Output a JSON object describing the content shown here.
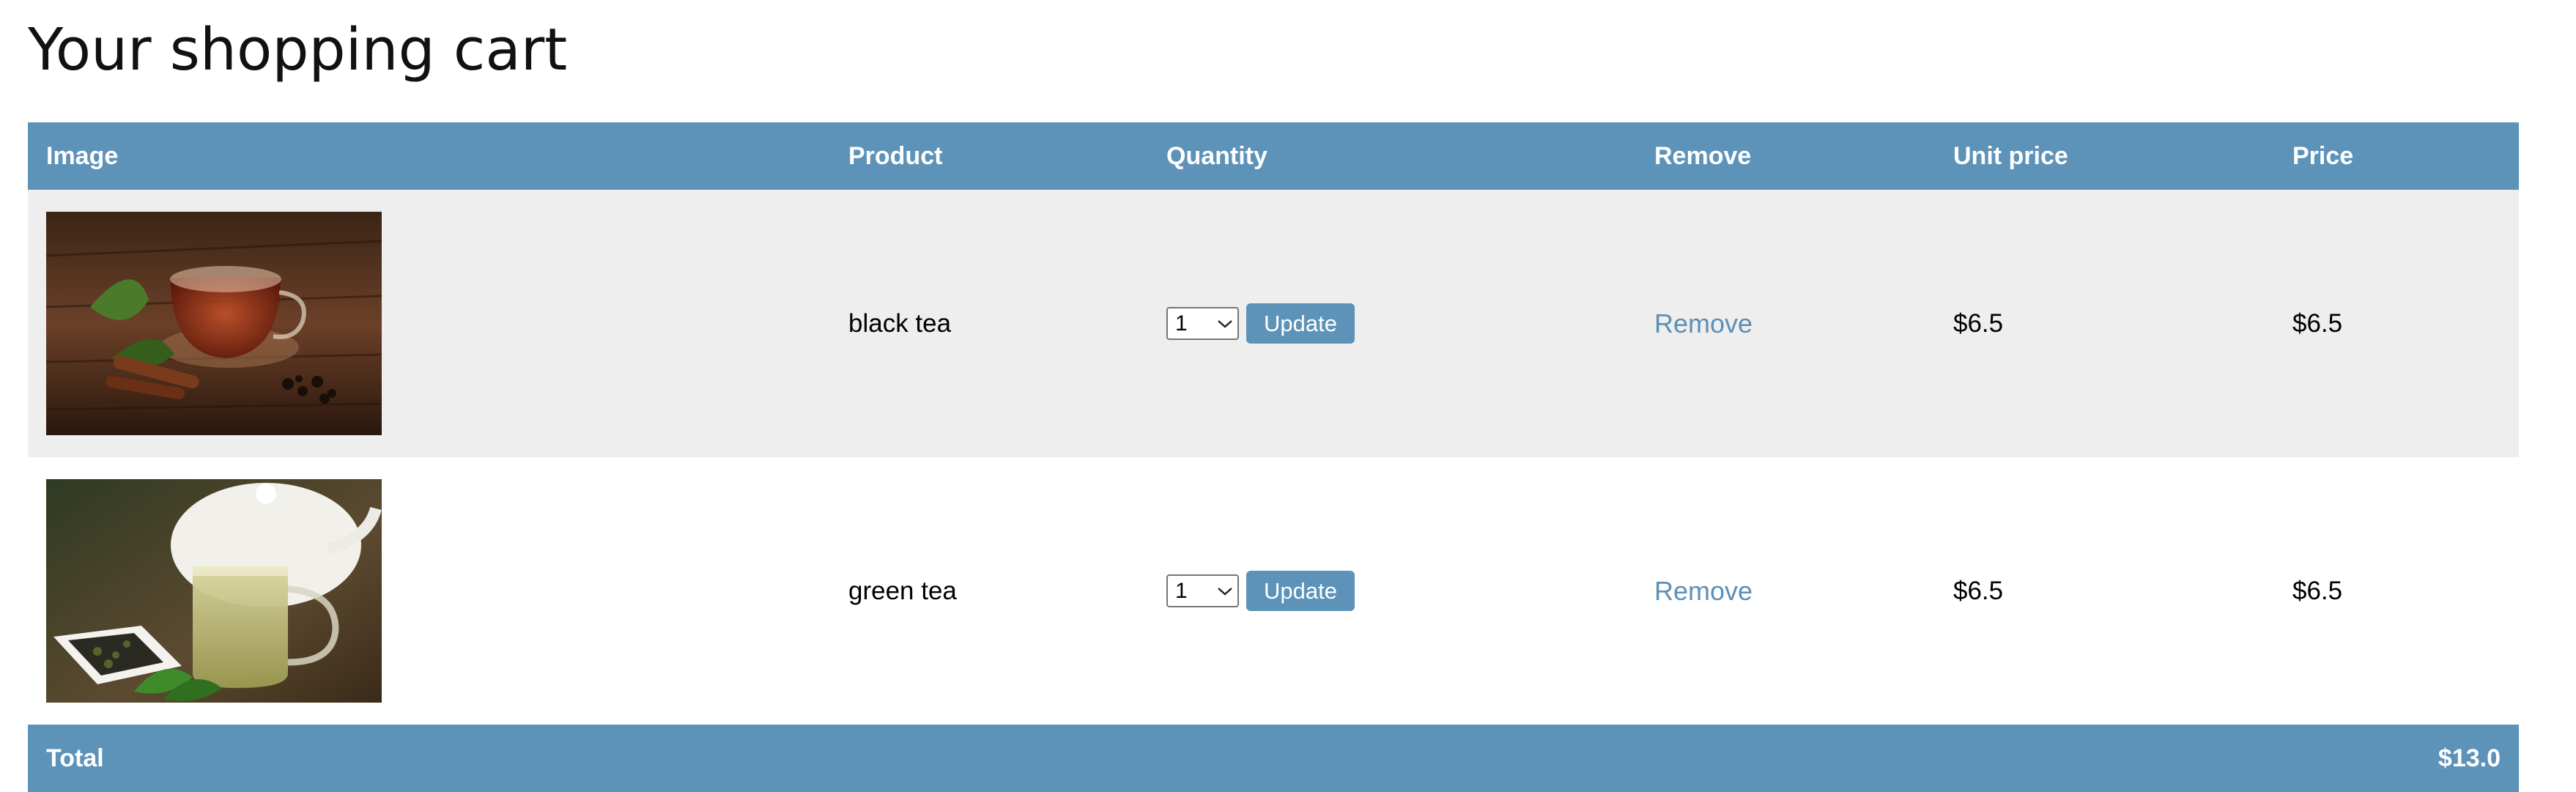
{
  "page": {
    "title": "Your shopping cart"
  },
  "colors": {
    "accent": "#5d93b9",
    "row_alt": "#eeeeee",
    "link": "#5d8fb5"
  },
  "cart": {
    "headers": {
      "image": "Image",
      "product": "Product",
      "quantity": "Quantity",
      "remove": "Remove",
      "unit_price": "Unit price",
      "price": "Price"
    },
    "items": [
      {
        "image_icon": "black-tea-cup-photo",
        "product": "black tea",
        "quantity": "1",
        "update_label": "Update",
        "remove_label": "Remove",
        "unit_price": "$6.5",
        "price": "$6.5"
      },
      {
        "image_icon": "green-tea-cup-photo",
        "product": "green tea",
        "quantity": "1",
        "update_label": "Update",
        "remove_label": "Remove",
        "unit_price": "$6.5",
        "price": "$6.5"
      }
    ],
    "total_label": "Total",
    "total_value": "$13.0"
  }
}
